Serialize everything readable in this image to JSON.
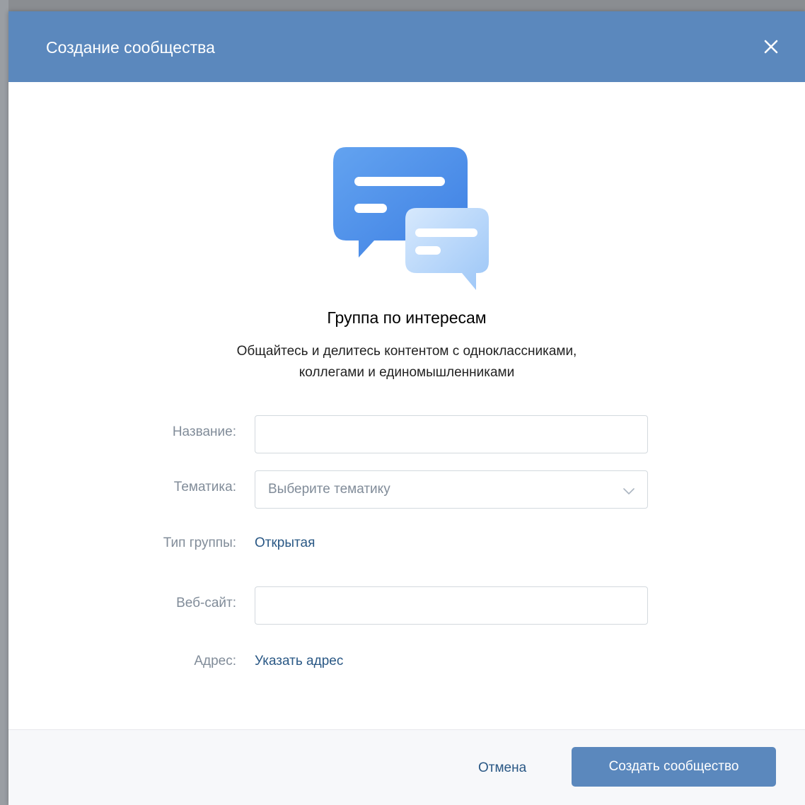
{
  "dialog": {
    "title": "Создание сообщества",
    "close_icon": "close-icon"
  },
  "intro": {
    "illustration_icon": "chat-bubbles-icon",
    "title": "Группа по интересам",
    "description_line1": "Общайтесь и делитесь контентом с одноклассниками,",
    "description_line2": "коллегами и единомышленниками"
  },
  "form": {
    "name_label": "Название:",
    "name_value": "",
    "topic_label": "Тематика:",
    "topic_placeholder": "Выберите тематику",
    "group_type_label": "Тип группы:",
    "group_type_value": "Открытая",
    "website_label": "Веб-сайт:",
    "website_value": "",
    "address_label": "Адрес:",
    "address_link": "Указать адрес"
  },
  "footer": {
    "cancel_label": "Отмена",
    "create_label": "Создать сообщество"
  },
  "colors": {
    "header_bg": "#5b88bd",
    "link": "#2a5885",
    "primary_button": "#5b88bd"
  }
}
